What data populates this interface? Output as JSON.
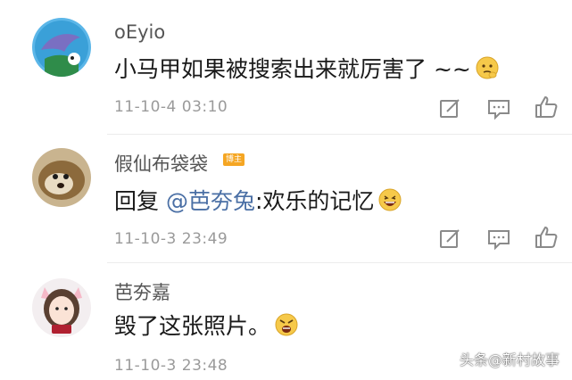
{
  "comments": [
    {
      "username": "oEyio",
      "text": "小马甲如果被搜索出来就厉害了 ~~",
      "time": "11-10-4 03:10",
      "emoji": "thinking-emoji"
    },
    {
      "username": "假仙布袋袋",
      "badge": "博主",
      "reply_prefix": "回复 ",
      "mention": "@芭夯兔",
      "text": ":欢乐的记忆",
      "time": "11-10-3 23:49",
      "emoji": "laughing-emoji"
    },
    {
      "username": "芭夯嘉",
      "text": "毁了这张照片。",
      "time": "11-10-3 23:48",
      "emoji": "angry-emoji"
    }
  ],
  "actions": [
    "edit-icon",
    "comment-icon",
    "like-icon"
  ],
  "watermark": "头条@新村故事",
  "colors": {
    "accent": "#4a6fa5",
    "badge": "#f5a623",
    "muted": "#9a9a9a"
  }
}
